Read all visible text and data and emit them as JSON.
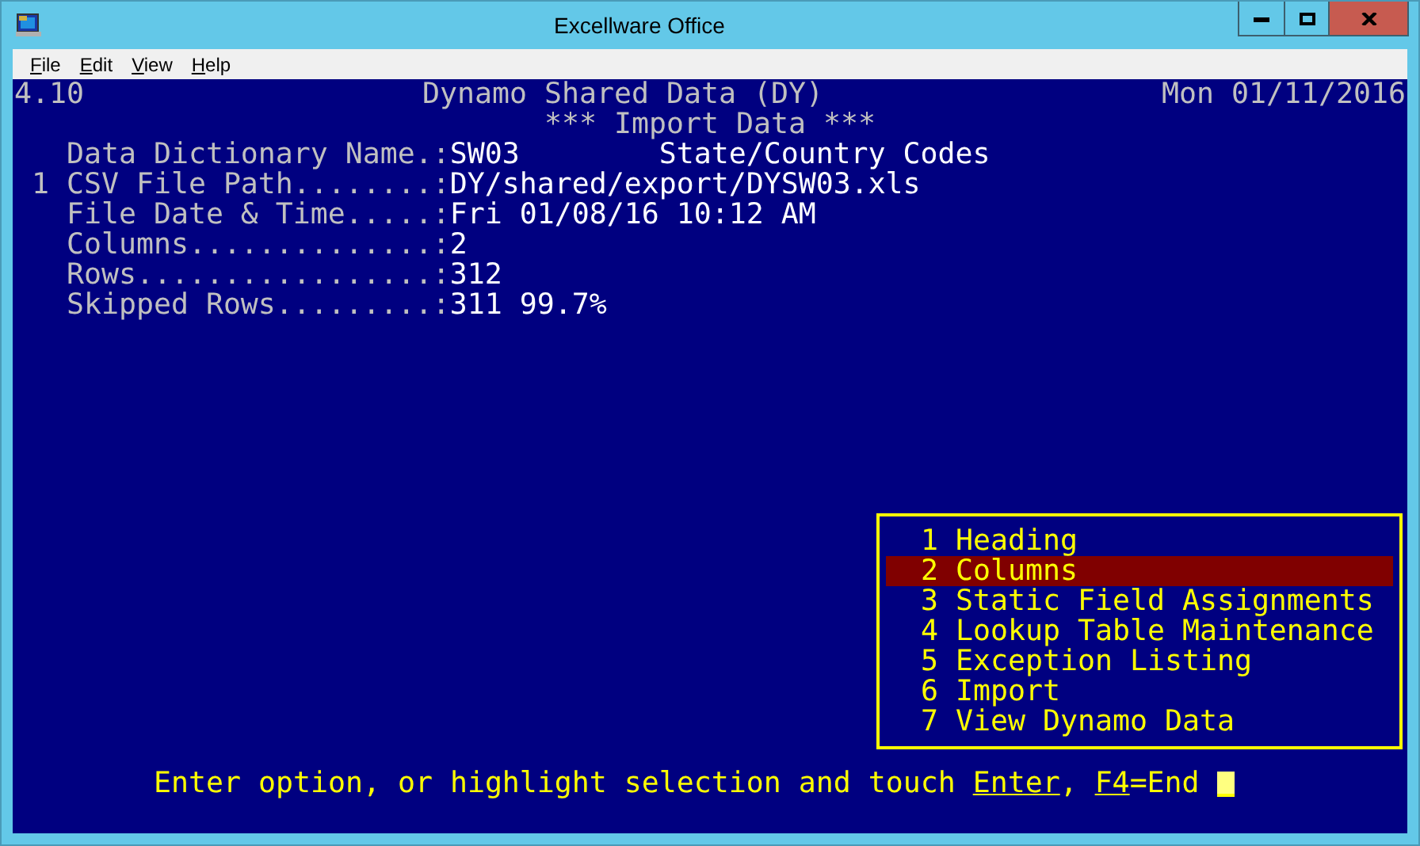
{
  "window": {
    "title": "Excellware Office"
  },
  "menu_bar": [
    "File",
    "Edit",
    "View",
    "Help"
  ],
  "header": {
    "version": "4.10",
    "title": "Dynamo Shared Data (DY)",
    "date": "Mon 01/11/2016",
    "subtitle": "*** Import Data ***"
  },
  "fields": [
    {
      "label": "Data Dictionary Name.:",
      "value": "SW03",
      "note": "State/Country Codes"
    },
    {
      "number": "1",
      "label": "CSV File Path........:",
      "value": "DY/shared/export/DYSW03.xls"
    },
    {
      "label": "File Date & Time.....:",
      "value": "Fri 01/08/16 10:12 AM"
    },
    {
      "label": "Columns..............:",
      "value": "2"
    },
    {
      "label": "Rows.................:",
      "value": "312"
    },
    {
      "label": "Skipped Rows.........:",
      "value": "311 99.7%"
    }
  ],
  "options": [
    {
      "number": "1",
      "label": "Heading",
      "selected": false
    },
    {
      "number": "2",
      "label": "Columns",
      "selected": true
    },
    {
      "number": "3",
      "label": "Static Field Assignments",
      "selected": false
    },
    {
      "number": "4",
      "label": "Lookup Table Maintenance",
      "selected": false
    },
    {
      "number": "5",
      "label": "Exception Listing",
      "selected": false
    },
    {
      "number": "6",
      "label": "Import",
      "selected": false
    },
    {
      "number": "7",
      "label": "View Dynamo Data",
      "selected": false
    }
  ],
  "prompt": {
    "text": "Enter option, or highlight selection and touch",
    "keys": [
      {
        "key": "Enter",
        "suffix": ","
      },
      {
        "key": "F4",
        "suffix": "=End"
      }
    ]
  }
}
